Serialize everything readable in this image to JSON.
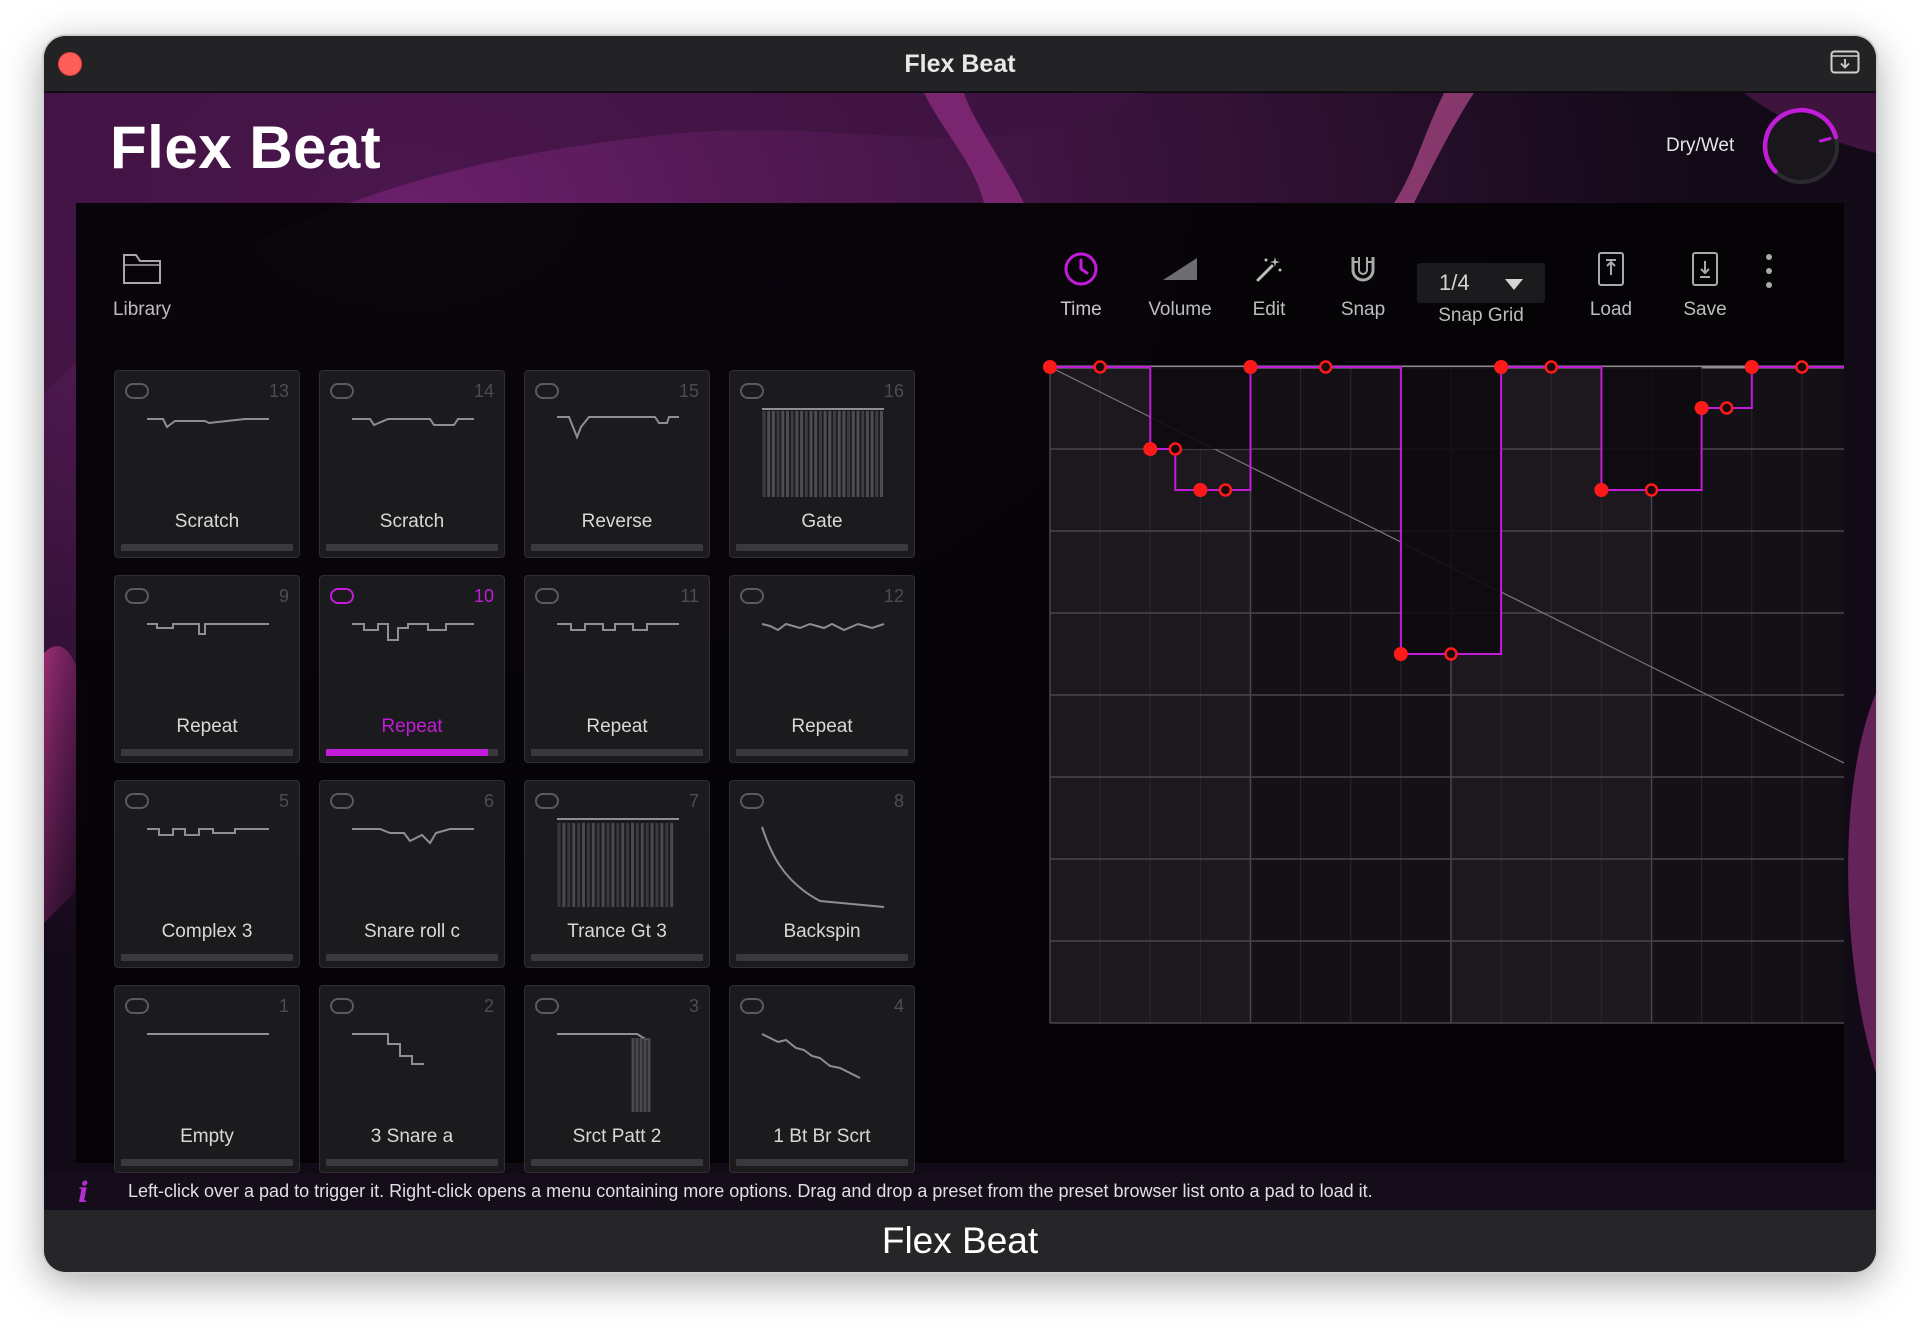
{
  "window": {
    "title": "Flex Beat"
  },
  "app": {
    "title": "Flex Beat",
    "drywet_label": "Dry/Wet",
    "drywet_value": 0.78
  },
  "toolbar": {
    "library": "Library",
    "time": "Time",
    "volume": "Volume",
    "edit": "Edit",
    "snap": "Snap",
    "snap_grid_value": "1/4",
    "snap_grid": "Snap Grid",
    "load": "Load",
    "save": "Save"
  },
  "pads": [
    {
      "num": "13",
      "label": "Scratch",
      "active": false
    },
    {
      "num": "14",
      "label": "Scratch",
      "active": false
    },
    {
      "num": "15",
      "label": "Reverse",
      "active": false
    },
    {
      "num": "16",
      "label": "Gate",
      "active": false
    },
    {
      "num": "9",
      "label": "Repeat",
      "active": false
    },
    {
      "num": "10",
      "label": "Repeat",
      "active": true
    },
    {
      "num": "11",
      "label": "Repeat",
      "active": false
    },
    {
      "num": "12",
      "label": "Repeat",
      "active": false
    },
    {
      "num": "5",
      "label": "Complex 3",
      "active": false
    },
    {
      "num": "6",
      "label": "Snare roll c",
      "active": false
    },
    {
      "num": "7",
      "label": "Trance Gt 3",
      "active": false
    },
    {
      "num": "8",
      "label": "Backspin",
      "active": false
    },
    {
      "num": "1",
      "label": "Empty",
      "active": false
    },
    {
      "num": "2",
      "label": "3 Snare a",
      "active": false
    },
    {
      "num": "3",
      "label": "Srct Patt 2",
      "active": false
    },
    {
      "num": "4",
      "label": "1 Bt Br Scrt",
      "active": false
    }
  ],
  "status": {
    "message": "Left-click over a pad to trigger it. Right-click opens a menu containing more options. Drag and drop a preset from the preset browser list onto a pad to load it."
  },
  "footer": {
    "title": "Flex Beat"
  },
  "colors": {
    "accent": "#c21cd8",
    "point": "#ff1a1a",
    "grid": "#4a4550"
  }
}
